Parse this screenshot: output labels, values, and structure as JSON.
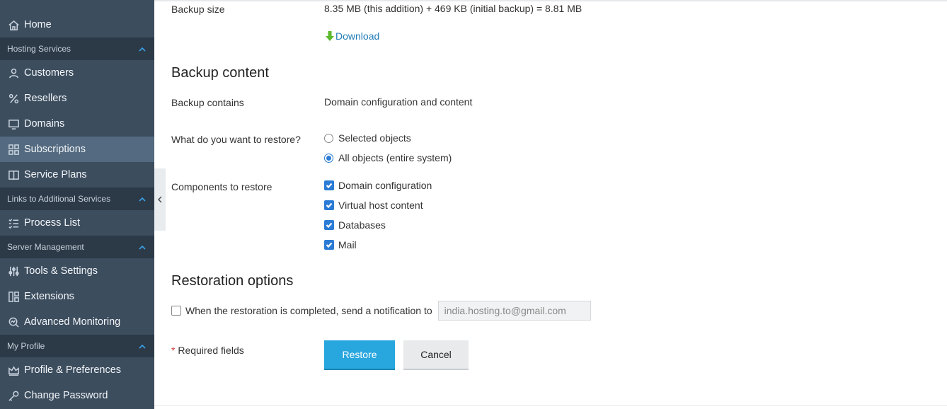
{
  "sidebar": {
    "home": "Home",
    "groups": {
      "hosting": "Hosting Services",
      "links": "Links to Additional Services",
      "server": "Server Management",
      "profile": "My Profile"
    },
    "items": {
      "customers": "Customers",
      "resellers": "Resellers",
      "domains": "Domains",
      "subscriptions": "Subscriptions",
      "service_plans": "Service Plans",
      "process_list": "Process List",
      "tools_settings": "Tools & Settings",
      "extensions": "Extensions",
      "advanced_monitoring": "Advanced Monitoring",
      "profile_preferences": "Profile & Preferences",
      "change_password": "Change Password"
    },
    "active_item": "subscriptions",
    "accent_color": "#3ba0e6"
  },
  "backup": {
    "size_label": "Backup size",
    "size_value": "8.35 MB (this addition) + 469 KB (initial backup) = 8.81 MB",
    "download_label": "Download"
  },
  "content": {
    "heading": "Backup content",
    "contains_label": "Backup contains",
    "contains_value": "Domain configuration and content",
    "restore_question": "What do you want to restore?",
    "restore_options": {
      "selected": "Selected objects",
      "all": "All objects (entire system)"
    },
    "restore_selected_value": "All objects (entire system)",
    "components_label": "Components to restore",
    "components": {
      "domain_config": "Domain configuration",
      "vhost": "Virtual host content",
      "databases": "Databases",
      "mail": "Mail"
    }
  },
  "restoration": {
    "heading": "Restoration options",
    "notify_label": "When the restoration is completed, send a notification to",
    "notify_email": "india.hosting.to@gmail.com",
    "notify_checked": false
  },
  "footer": {
    "required_star": "*",
    "required_text": " Required fields",
    "restore_button": "Restore",
    "cancel_button": "Cancel",
    "primary_color": "#28a6de"
  }
}
